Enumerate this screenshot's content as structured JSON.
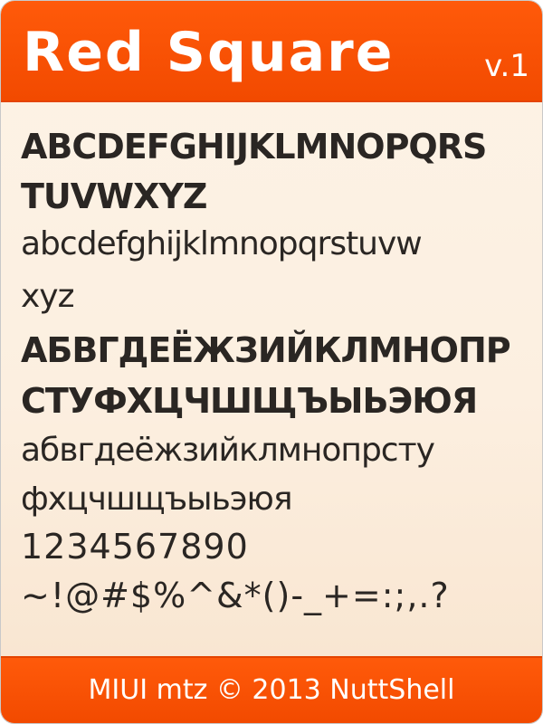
{
  "header": {
    "title": "Red Square",
    "version": "v.1"
  },
  "specimen": {
    "latin_upper_1": "ABCDEFGHIJKLMNOPQRS",
    "latin_upper_2": "TUVWXYZ",
    "latin_lower_1": "abcdefghijklmnopqrstuvw",
    "latin_lower_2": "xyz",
    "cyrillic_upper_1": "АБВГДЕЁЖЗИЙКЛМНОПР",
    "cyrillic_upper_2": "СТУФХЦЧШЩЪЫЬЭЮЯ",
    "cyrillic_lower_1": "абвгдеёжзийклмнопрсту",
    "cyrillic_lower_2": "фхцчшщъыьэюя",
    "digits": "1234567890",
    "symbols": "~!@#$%^&*()-_+=:;,.?"
  },
  "footer": {
    "credit": "MIUI mtz © 2013 NuttShell"
  },
  "colors": {
    "accent": "#f24a00",
    "background": "#fcefe0",
    "text": "#2a2623"
  }
}
